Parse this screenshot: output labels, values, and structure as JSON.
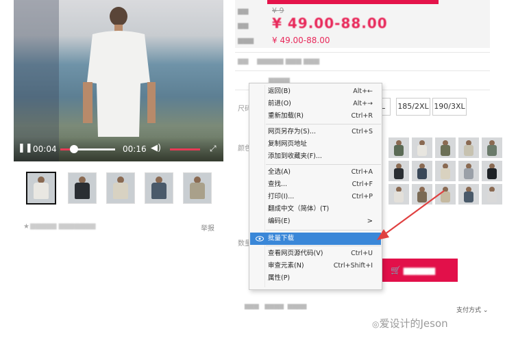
{
  "video": {
    "current_time": "00:04",
    "total_time": "00:16",
    "progress": 0.25
  },
  "thumbnails": [
    {
      "shirt_color": "#e9e7e2",
      "selected": true
    },
    {
      "shirt_color": "#2a2e33",
      "selected": false
    },
    {
      "shirt_color": "#d8d2c2",
      "selected": false
    },
    {
      "shirt_color": "#4a5a6a",
      "selected": false
    },
    {
      "shirt_color": "#a9a08a",
      "selected": false
    }
  ],
  "left_footer": {
    "report": "举报"
  },
  "product": {
    "old_price": "¥ 9",
    "sale_price": "¥ 49.00-88.00",
    "range_price": "¥ 49.00-88.00",
    "sizes": [
      "L",
      "185/2XL",
      "190/3XL"
    ],
    "size_label": "尺码",
    "color_label": "颜色",
    "qty_label": "数量",
    "payment": "支付方式",
    "color_thumbs": [
      "#5a6a55",
      "#e8e6e0",
      "#6b6f55",
      "#c7c2b0",
      "#6a7a6a",
      "#2a2e33",
      "#3a4858",
      "#d9d2c0",
      "#9aa0a8",
      "#1e2226",
      "#e3e0da",
      "#7a6a55",
      "#c5b9a0",
      "#4a5a6a",
      "#d9d9d9"
    ]
  },
  "menu": {
    "items": [
      {
        "label": "返回(B)",
        "shortcut": "Alt+←"
      },
      {
        "label": "前进(O)",
        "shortcut": "Alt+→"
      },
      {
        "label": "重新加载(R)",
        "shortcut": "Ctrl+R"
      },
      {
        "label": "网页另存为(S)...",
        "shortcut": "Ctrl+S"
      },
      {
        "label": "复制网页地址",
        "shortcut": ""
      },
      {
        "label": "添加到收藏夹(F)...",
        "shortcut": ""
      },
      {
        "label": "全选(A)",
        "shortcut": "Ctrl+A"
      },
      {
        "label": "查找...",
        "shortcut": "Ctrl+F"
      },
      {
        "label": "打印(I)...",
        "shortcut": "Ctrl+P"
      },
      {
        "label": "翻成中文（简体）(T)",
        "shortcut": ""
      },
      {
        "label": "编码(E)",
        "shortcut": ">"
      },
      {
        "label": "批量下载",
        "shortcut": ""
      },
      {
        "label": "查看网页源代码(V)",
        "shortcut": "Ctrl+U"
      },
      {
        "label": "审查元素(N)",
        "shortcut": "Ctrl+Shift+I"
      },
      {
        "label": "属性(P)",
        "shortcut": ""
      }
    ]
  },
  "watermark": "爱设计的Jeson",
  "colors": {
    "accent": "#e2104a",
    "highlight": "#3a87d8"
  }
}
